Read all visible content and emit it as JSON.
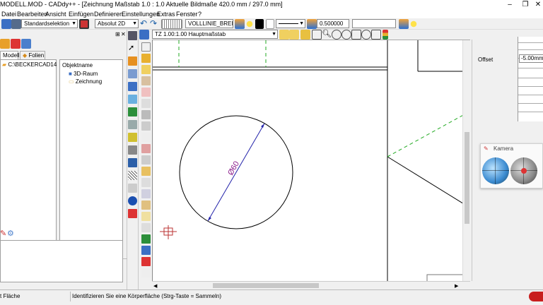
{
  "window": {
    "title": "MODELL.MOD  -  CADdy++ - [Zeichnung   Maßstab 1.0 : 1.0   Aktuelle Bildmaße 420.0 mm / 297.0 mm]",
    "minimize_glyph": "–",
    "restore_glyph": "❐",
    "close_glyph": "✕"
  },
  "menu": [
    "Datei",
    "Bearbeiten",
    "Ansicht",
    "Einfügen",
    "Definieren",
    "Einstellungen",
    "Extras",
    "Fenster",
    "?"
  ],
  "toolbar": {
    "selection_combo": "Standardselektion",
    "mode_combo": "Absolut 2D",
    "linetype_combo": "VOLLLINIE_BREIT",
    "width_value": "0.500000",
    "icons": [
      "new-icon",
      "save-icon",
      "undo-icon",
      "redo-icon",
      "pattern-icon",
      "layer-icon",
      "lightbulb-icon",
      "color-icon"
    ]
  },
  "subtoolbar": {
    "scale_combo": "TZ 1.00:1.00 Hauptmaßstab"
  },
  "leftpanel": {
    "tabs": [
      "Modell",
      "Folien"
    ],
    "tree_root": "C:\\BECKERCAD14",
    "objects_header": "Objektname",
    "objects": [
      "3D-Raum",
      "Zeichnung"
    ]
  },
  "drawing": {
    "dimension_text": "Ø60",
    "colors": {
      "dimension": "#8b1a8b",
      "dimension_line": "#2222aa",
      "green_dashed": "#22aa22",
      "lines": "#000000"
    }
  },
  "rightpanel": {
    "offset_label": "Offset",
    "offset_value": "-5.00mm"
  },
  "camera": {
    "title": "Kamera"
  },
  "statusbar": {
    "left_text": "t Fläche",
    "prompt_text": "Identifizieren Sie eine Körperfläche (Strg-Taste = Sammeln)"
  }
}
